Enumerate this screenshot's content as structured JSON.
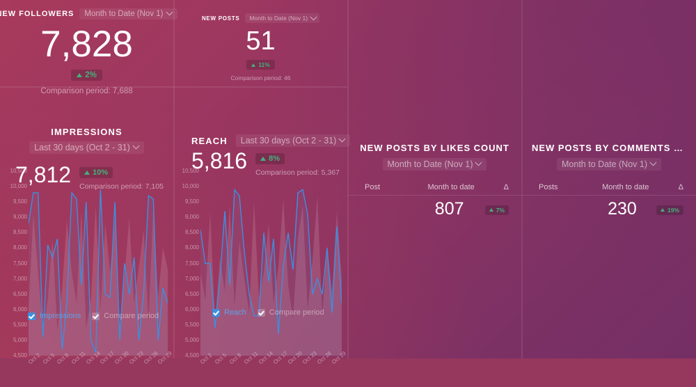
{
  "theme": {
    "bg_top_right": "#742f65",
    "bg_bottom_left": "#a83a5c",
    "accent_blue": "#3d8fe0",
    "positive_green": "#45b07c",
    "divider": "rgba(255,255,255,0.085)"
  },
  "tiles": {
    "new_followers": {
      "title": "NEW FOLLOWERS",
      "period": "Month to Date (Nov 1)",
      "value": "7,828",
      "delta": "2%",
      "delta_direction": "up",
      "comparison": "Comparison period: 7,688"
    },
    "new_posts": {
      "title": "NEW POSTS",
      "period": "Month to Date (Nov 1)",
      "value": "51",
      "delta": "11%",
      "delta_direction": "up",
      "comparison": "Comparison period: 46"
    }
  },
  "charts": {
    "impressions": {
      "title": "IMPRESSIONS",
      "period": "Last 30 days (Oct 2 - 31)",
      "value": "7,812",
      "delta": "10%",
      "delta_direction": "up",
      "comparison": "Comparison period: 7,105",
      "legend": {
        "series_label": "Impressions",
        "compare_label": "Compare period"
      }
    },
    "reach": {
      "title": "REACH",
      "period": "Last 30 days (Oct 2 - 31)",
      "value": "5,816",
      "delta": "8%",
      "delta_direction": "up",
      "comparison": "Comparison period: 5,367",
      "legend": {
        "series_label": "Reach",
        "compare_label": "Compare period"
      }
    }
  },
  "tables": {
    "likes": {
      "title": "NEW POSTS BY LIKES COUNT",
      "period": "Month to Date (Nov 1)",
      "columns": [
        "Post",
        "Month to date",
        "Δ"
      ],
      "rows": [
        {
          "post": "",
          "value": "807",
          "delta": "7%",
          "delta_direction": "up"
        }
      ]
    },
    "comments": {
      "title": "NEW POSTS BY COMMENTS COU…",
      "period": "Month to Date (Nov 1)",
      "columns": [
        "Posts",
        "Month to date",
        "Δ"
      ],
      "rows": [
        {
          "post": "",
          "value": "230",
          "delta": "19%",
          "delta_direction": "up"
        }
      ]
    }
  },
  "chart_data": [
    {
      "type": "line",
      "title": "IMPRESSIONS",
      "ylabel": "",
      "xlabel": "",
      "ylim": [
        4500,
        10500
      ],
      "grid": false,
      "legend_position": "bottom",
      "ytick_labels": [
        "10,500",
        "10,000",
        "9,500",
        "9,000",
        "8,500",
        "8,000",
        "7,500",
        "7,000",
        "6,500",
        "6,000",
        "5,500",
        "5,000",
        "4,500"
      ],
      "xtick_labels": [
        "Oct 2",
        "Oct 5",
        "Oct 8",
        "Oct 11",
        "Oct 14",
        "Oct 17",
        "Oct 20",
        "Oct 23",
        "Oct 26",
        "Oct 29"
      ],
      "x": [
        "Oct 2",
        "Oct 3",
        "Oct 4",
        "Oct 5",
        "Oct 6",
        "Oct 7",
        "Oct 8",
        "Oct 9",
        "Oct 10",
        "Oct 11",
        "Oct 12",
        "Oct 13",
        "Oct 14",
        "Oct 15",
        "Oct 16",
        "Oct 17",
        "Oct 18",
        "Oct 19",
        "Oct 20",
        "Oct 21",
        "Oct 22",
        "Oct 23",
        "Oct 24",
        "Oct 25",
        "Oct 26",
        "Oct 27",
        "Oct 28",
        "Oct 29",
        "Oct 30",
        "Oct 31"
      ],
      "series": [
        {
          "name": "Impressions",
          "color": "#3d8fe0",
          "values": [
            8800,
            9800,
            9800,
            5100,
            8100,
            7700,
            8300,
            4700,
            6300,
            9800,
            9600,
            6800,
            9500,
            5000,
            4600,
            9900,
            6500,
            6400,
            9500,
            5000,
            7500,
            6500,
            7700,
            5000,
            6600,
            9700,
            9600,
            5000,
            6700,
            6200
          ]
        },
        {
          "name": "Compare period",
          "color": "rgba(255,255,255,0.13)",
          "values": [
            6000,
            9100,
            7200,
            5300,
            6300,
            8300,
            5300,
            6700,
            8900,
            7200,
            6200,
            9200,
            5400,
            6300,
            9400,
            6000,
            8800,
            7200,
            8900,
            5500,
            7100,
            9000,
            6200,
            7400,
            8600,
            5600,
            9300,
            6400,
            8000,
            7300
          ]
        }
      ]
    },
    {
      "type": "line",
      "title": "REACH",
      "ylabel": "",
      "xlabel": "",
      "ylim": [
        4500,
        10500
      ],
      "grid": false,
      "legend_position": "bottom",
      "ytick_labels": [
        "10,500",
        "10,000",
        "9,500",
        "9,000",
        "8,500",
        "8,000",
        "7,500",
        "7,000",
        "6,500",
        "6,000",
        "5,500",
        "5,000",
        "4,500"
      ],
      "xtick_labels": [
        "Oct 2",
        "Oct 5",
        "Oct 8",
        "Oct 11",
        "Oct 14",
        "Oct 17",
        "Oct 20",
        "Oct 23",
        "Oct 26",
        "Oct 29"
      ],
      "x": [
        "Oct 2",
        "Oct 3",
        "Oct 4",
        "Oct 5",
        "Oct 6",
        "Oct 7",
        "Oct 8",
        "Oct 9",
        "Oct 10",
        "Oct 11",
        "Oct 12",
        "Oct 13",
        "Oct 14",
        "Oct 15",
        "Oct 16",
        "Oct 17",
        "Oct 18",
        "Oct 19",
        "Oct 20",
        "Oct 21",
        "Oct 22",
        "Oct 23",
        "Oct 24",
        "Oct 25",
        "Oct 26",
        "Oct 27",
        "Oct 28",
        "Oct 29",
        "Oct 30",
        "Oct 31"
      ],
      "series": [
        {
          "name": "Reach",
          "color": "#3d8fe0",
          "values": [
            8600,
            7500,
            7500,
            5400,
            7000,
            9200,
            6800,
            9900,
            9700,
            7900,
            6500,
            5800,
            5800,
            8500,
            6900,
            8300,
            5200,
            7400,
            8500,
            7300,
            9800,
            9900,
            9100,
            6500,
            7000,
            6500,
            8000,
            5900,
            8700,
            6200
          ]
        },
        {
          "name": "Compare period",
          "color": "rgba(255,255,255,0.13)",
          "values": [
            7200,
            6300,
            9200,
            5600,
            7700,
            6600,
            9400,
            6100,
            8200,
            7000,
            5900,
            9500,
            6400,
            7200,
            8800,
            6200,
            7400,
            9600,
            6800,
            5700,
            8300,
            9400,
            6000,
            7600,
            9700,
            5800,
            8100,
            6600,
            9200,
            7000
          ]
        }
      ]
    }
  ]
}
